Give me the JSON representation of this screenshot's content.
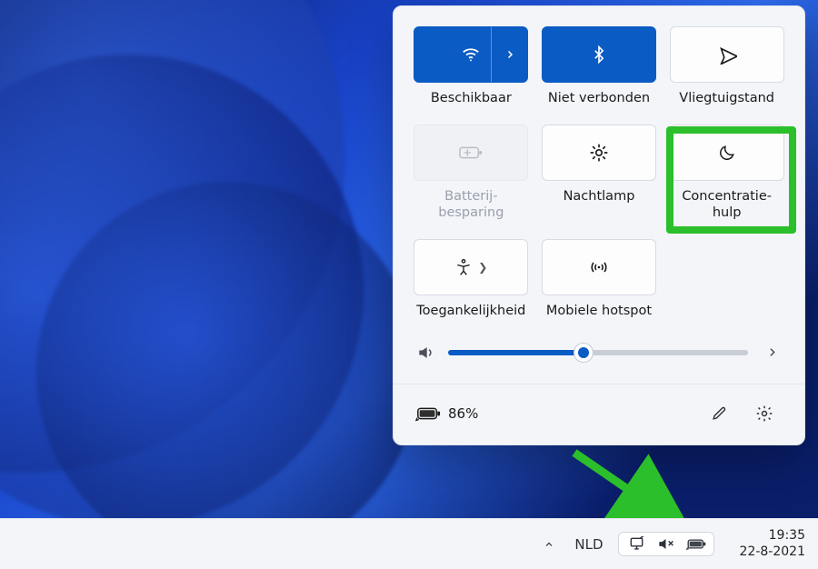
{
  "tiles": {
    "wifi": {
      "label": "Beschikbaar"
    },
    "bluetooth": {
      "label": "Niet verbonden"
    },
    "airplane": {
      "label": "Vliegtuigstand"
    },
    "battery_saver": {
      "label": "Batterij-\nbesparing"
    },
    "nightlight": {
      "label": "Nachtlamp"
    },
    "focus": {
      "label": "Concentratie-\nhulp"
    },
    "accessibility": {
      "label": "Toegankelijkheid"
    },
    "hotspot": {
      "label": "Mobiele hotspot"
    }
  },
  "volume": {
    "percent": 45
  },
  "battery": {
    "percent_label": "86%"
  },
  "taskbar": {
    "language": "NLD",
    "time": "19:35",
    "date": "22-8-2021"
  }
}
